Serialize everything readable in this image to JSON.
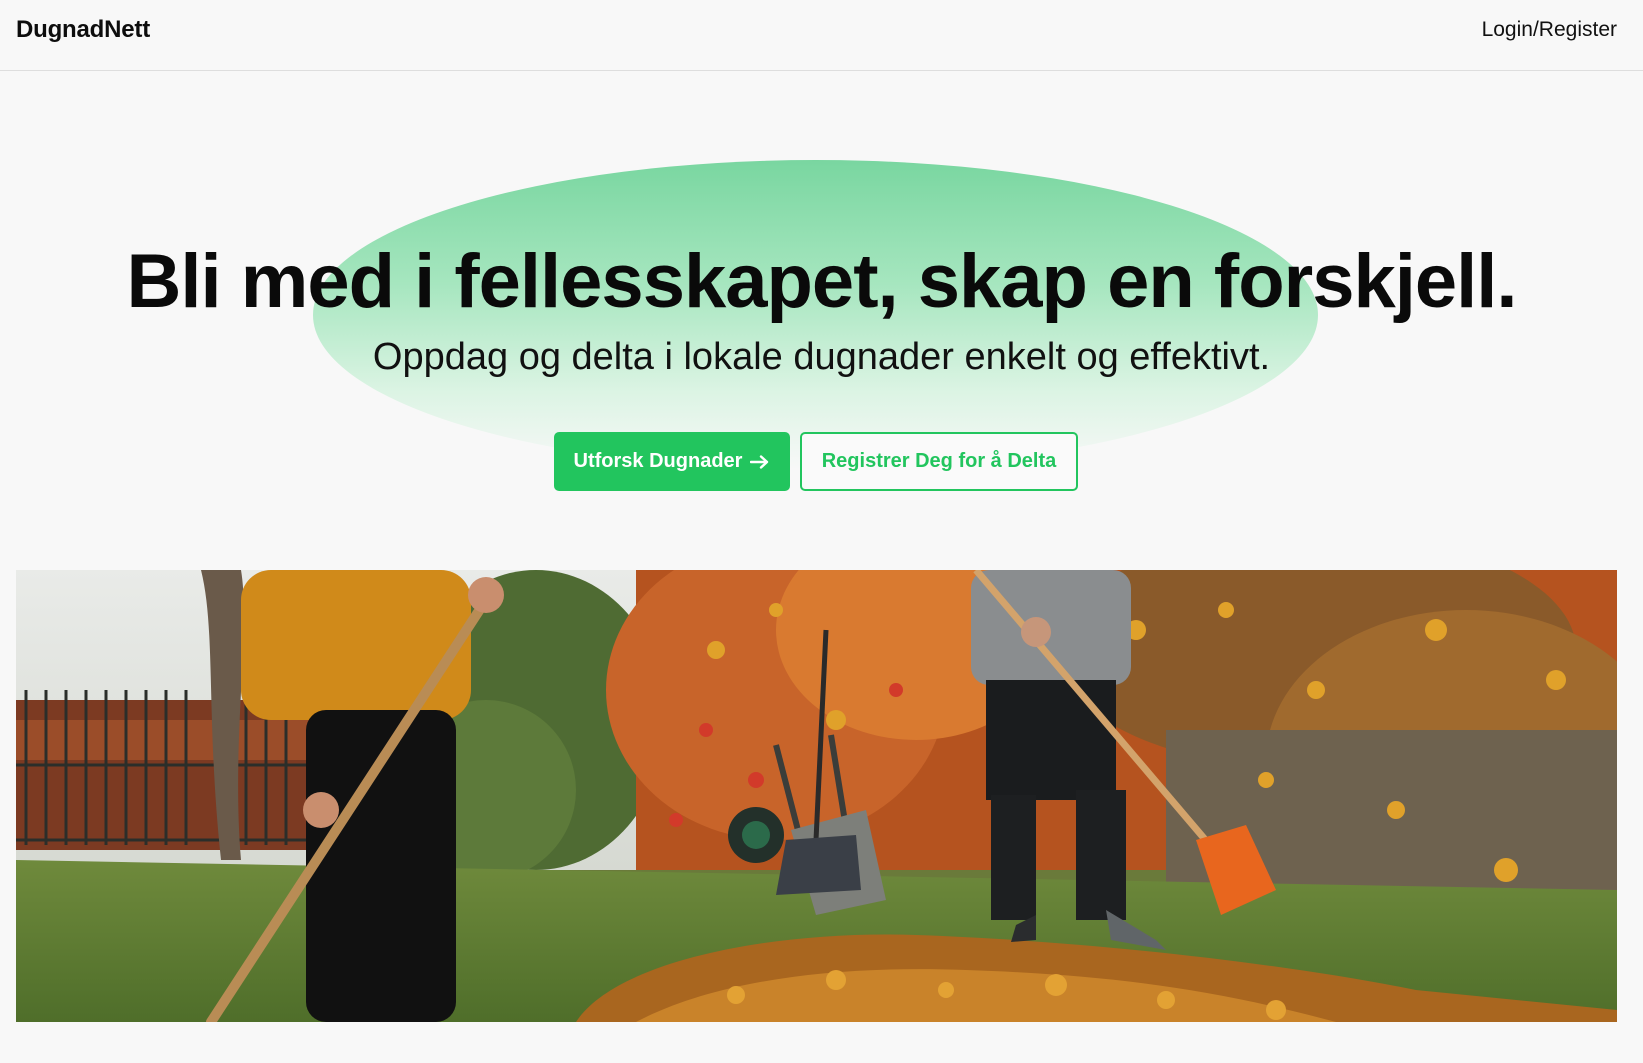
{
  "header": {
    "brand": "DugnadNett",
    "login_label": "Login/Register"
  },
  "hero": {
    "title": "Bli med i fellesskapet, skap en forskjell.",
    "subtitle": "Oppdag og delta i lokale dugnader enkelt og effektivt.",
    "primary_button": "Utforsk Dugnader",
    "secondary_button": "Registrer Deg for å Delta",
    "image_alt": "two people raking autumn leaves in a garden"
  },
  "colors": {
    "accent": "#22c55e",
    "background": "#f8f8f8",
    "blob": "#79d6a0"
  },
  "icons": {
    "primary_button_icon": "arrow-right-icon"
  }
}
